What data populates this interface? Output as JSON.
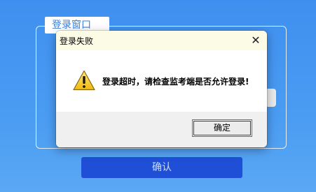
{
  "background": {
    "panel_title": "登录窗口",
    "confirm_label": "确认"
  },
  "dialog": {
    "title": "登录失败",
    "close_glyph": "✕",
    "message": "登录超时，请检查监考端是否允许登录!",
    "ok_label": "确定",
    "icon": "warning-icon"
  },
  "colors": {
    "background_blue": "#4a9cf2",
    "confirm_button": "#1f4fd6",
    "titlebar": "#fbfbe6"
  }
}
